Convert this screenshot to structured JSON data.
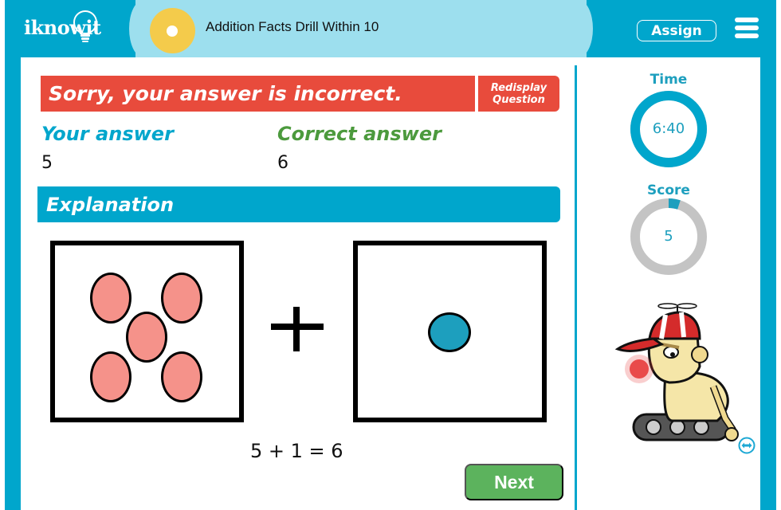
{
  "header": {
    "logo_text": "iknowit",
    "activity_title": "Addition Facts Drill Within 10",
    "assign_label": "Assign",
    "menu_icon": "hamburger-menu-icon",
    "activity_icon": "yellow-dot-icon"
  },
  "feedback": {
    "message": "Sorry, your answer is incorrect.",
    "redisplay_line1": "Redisplay",
    "redisplay_line2": "Question"
  },
  "answers": {
    "your_answer_label": "Your answer",
    "your_answer_value": "5",
    "correct_answer_label": "Correct answer",
    "correct_answer_value": "6"
  },
  "explanation": {
    "title": "Explanation",
    "left_group_count": 5,
    "right_group_count": 1,
    "operator": "+",
    "equation": "5 + 1 = 6"
  },
  "next_label": "Next",
  "sidebar": {
    "time_label": "Time",
    "time_value": "6:40",
    "time_progress": 1.0,
    "score_label": "Score",
    "score_value": "5",
    "score_progress": 0.05,
    "mascot": "robot-mascot",
    "swap_icon": "swap-horizontal-icon"
  },
  "colors": {
    "brand_blue": "#00a6cc",
    "light_blue": "#9ddfee",
    "error_red": "#e84b3c",
    "correct_green": "#4c9a3d",
    "next_green": "#5cb35d",
    "pink_counter": "#f5928a",
    "blue_counter": "#1d9fbe",
    "ring_gray": "#c4c4c4"
  }
}
